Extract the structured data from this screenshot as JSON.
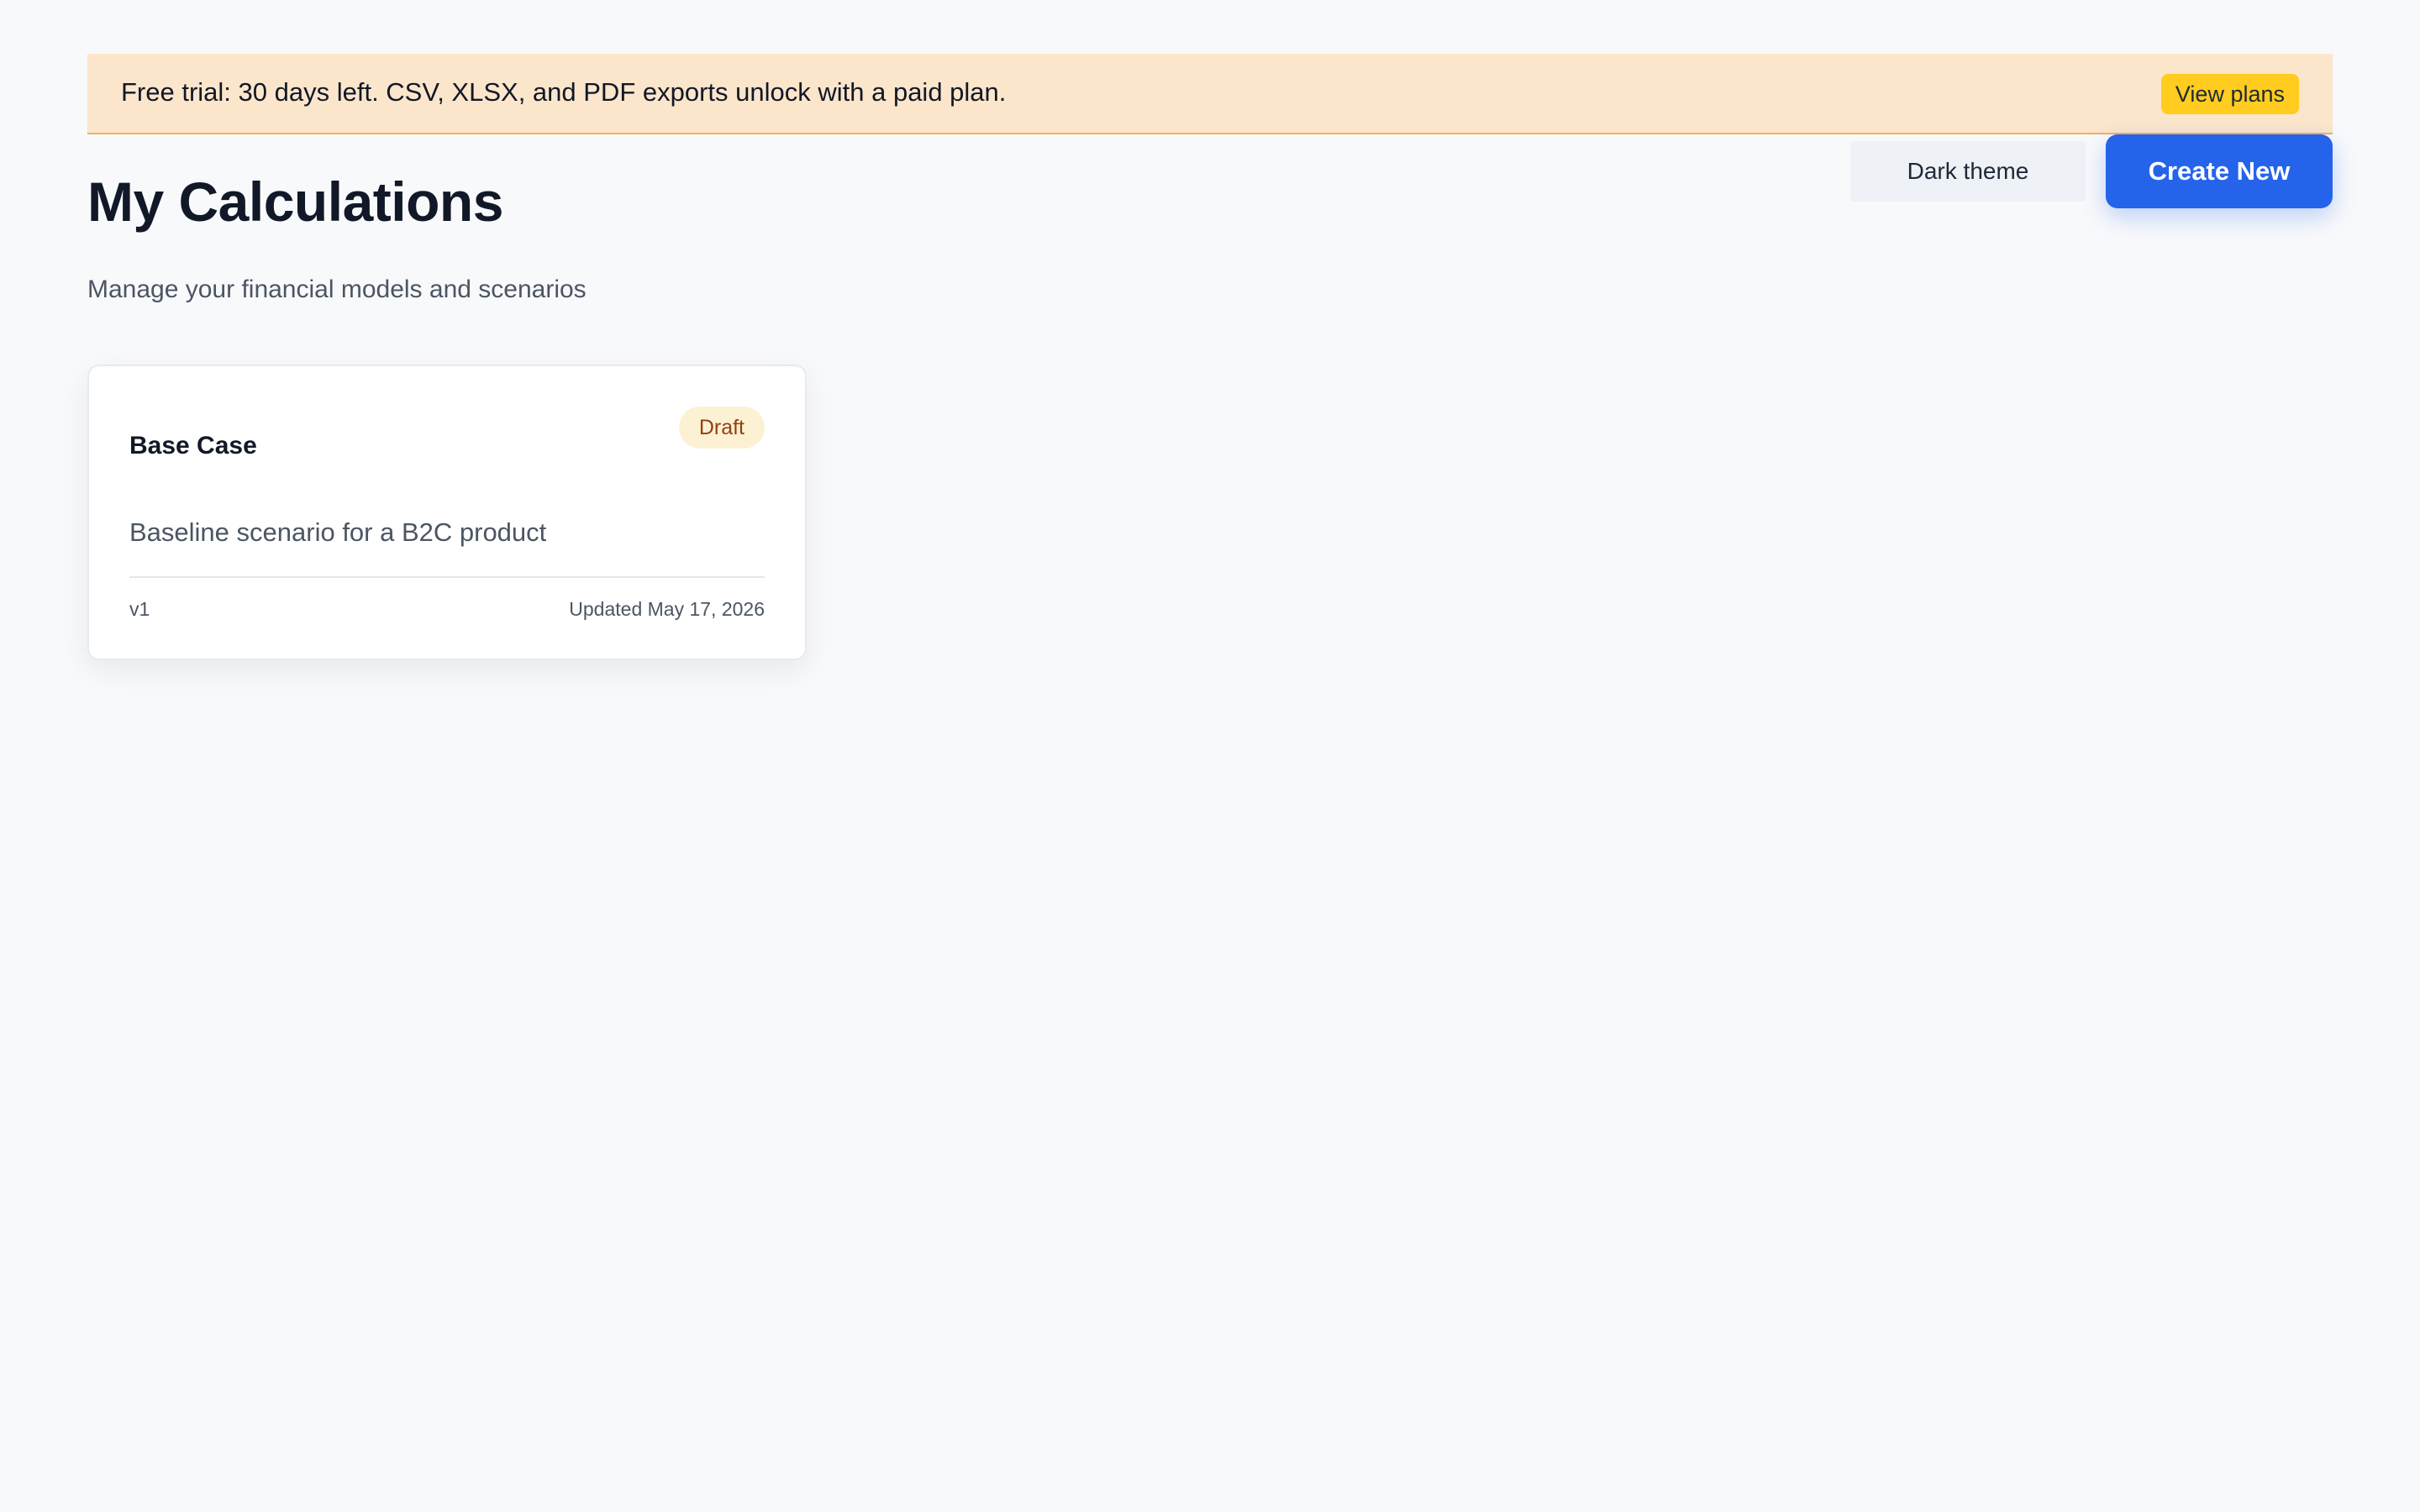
{
  "banner": {
    "message": "Free trial: 30 days left. CSV, XLSX, and PDF exports unlock with a paid plan.",
    "action_label": "View plans"
  },
  "header": {
    "title": "My Calculations",
    "subtitle": "Manage your financial models and scenarios",
    "theme_toggle_label": "Dark theme",
    "create_label": "Create New"
  },
  "calculations": [
    {
      "title": "Base Case",
      "status": "Draft",
      "description": "Baseline scenario for a B2C product",
      "version": "v1",
      "updated": "Updated May 17, 2026"
    }
  ],
  "colors": {
    "background": "#f8f9fb",
    "banner_background": "#fce6cb",
    "banner_border": "#f0b35a",
    "view_plans_button": "#ffcc1f",
    "primary_accent": "#2563eb",
    "draft_badge_background": "#fdf1d4",
    "draft_badge_text": "#92400e"
  }
}
